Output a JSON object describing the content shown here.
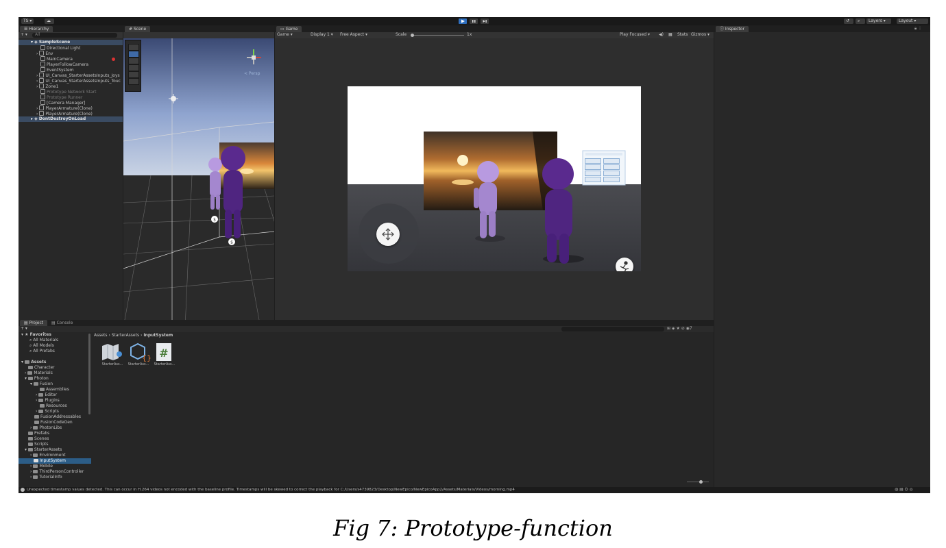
{
  "toolbar": {
    "account": "TS",
    "cloud_icon": "cloud-icon",
    "play_icon": "play-icon",
    "pause_icon": "pause-icon",
    "step_icon": "step-icon",
    "history_icon": "history-icon",
    "search_icon": "search-icon",
    "layers": "Layers",
    "layout": "Layout"
  },
  "hierarchy": {
    "tab": "Hierarchy",
    "search_placeholder": "All",
    "scene_root": "SampleScene",
    "items": [
      "Directional Light",
      "Env",
      "MainCamera",
      "PlayerFollowCamera",
      "EventSystem",
      "UI_Canvas_StarterAssetsInputs_Joys",
      "UI_Canvas_StarterAssetsInputs_Touc",
      "Zone1",
      "Prototype Network Start",
      "Prototype Runner",
      "[Camera Manager]",
      "PlayerArmature(Clone)",
      "PlayerArmature(Clone)"
    ],
    "dont_destroy": "DontDestroyOnLoad"
  },
  "scene": {
    "tab": "Scene",
    "persp_label": "< Persp"
  },
  "game": {
    "tab": "Game",
    "display_mode": "Game",
    "display": "Display 1",
    "aspect": "Free Aspect",
    "scale_label": "Scale",
    "scale_value": "1x",
    "play_focused": "Play Focused",
    "stats": "Stats",
    "gizmos": "Gizmos"
  },
  "inspector": {
    "tab": "Inspector"
  },
  "project": {
    "tab_project": "Project",
    "tab_console": "Console",
    "breadcrumb": [
      "Assets",
      "StarterAssets",
      "InputSystem"
    ],
    "favorites_label": "Favorites",
    "favorites": [
      "All Materials",
      "All Models",
      "All Prefabs"
    ],
    "assets_label": "Assets",
    "tree": [
      "Character",
      "Materials",
      "Photon",
      "Fusion",
      "Assemblies",
      "Editor",
      "Plugins",
      "Resources",
      "Scripts",
      "FusionAddressables",
      "FusionCodeGen",
      "PhotonLibs",
      "Prefabs",
      "Scenes",
      "Scripts",
      "StarterAssets",
      "Environment",
      "InputSystem",
      "Mobile",
      "ThirdPersonController",
      "TutorialInfo"
    ],
    "assets": [
      {
        "label": "StarterAss...",
        "icon": "input-actions-icon"
      },
      {
        "label": "StarterAss...",
        "icon": "package-json-icon"
      },
      {
        "label": "StarterAss...",
        "icon": "csharp-script-icon"
      }
    ]
  },
  "status_bar": {
    "message": "Unexpected timestamp values detected. This can occur in H.264 videos not encoded with the baseline profile. Timestamps will be skewed to correct the playback for C:/Users/s4739823/Desktop/NewEpico/NewEpicoApp2/Assets/Materials/Videos/morning.mp4"
  },
  "caption": "Fig 7: Prototype-function",
  "colors": {
    "editor_bg": "#1e1e1e",
    "panel_bg": "#282828",
    "accent_blue": "#2f6fbf",
    "selection": "#2c5d87",
    "character_dark": "#5a2a8e",
    "character_light": "#b89ae0"
  }
}
